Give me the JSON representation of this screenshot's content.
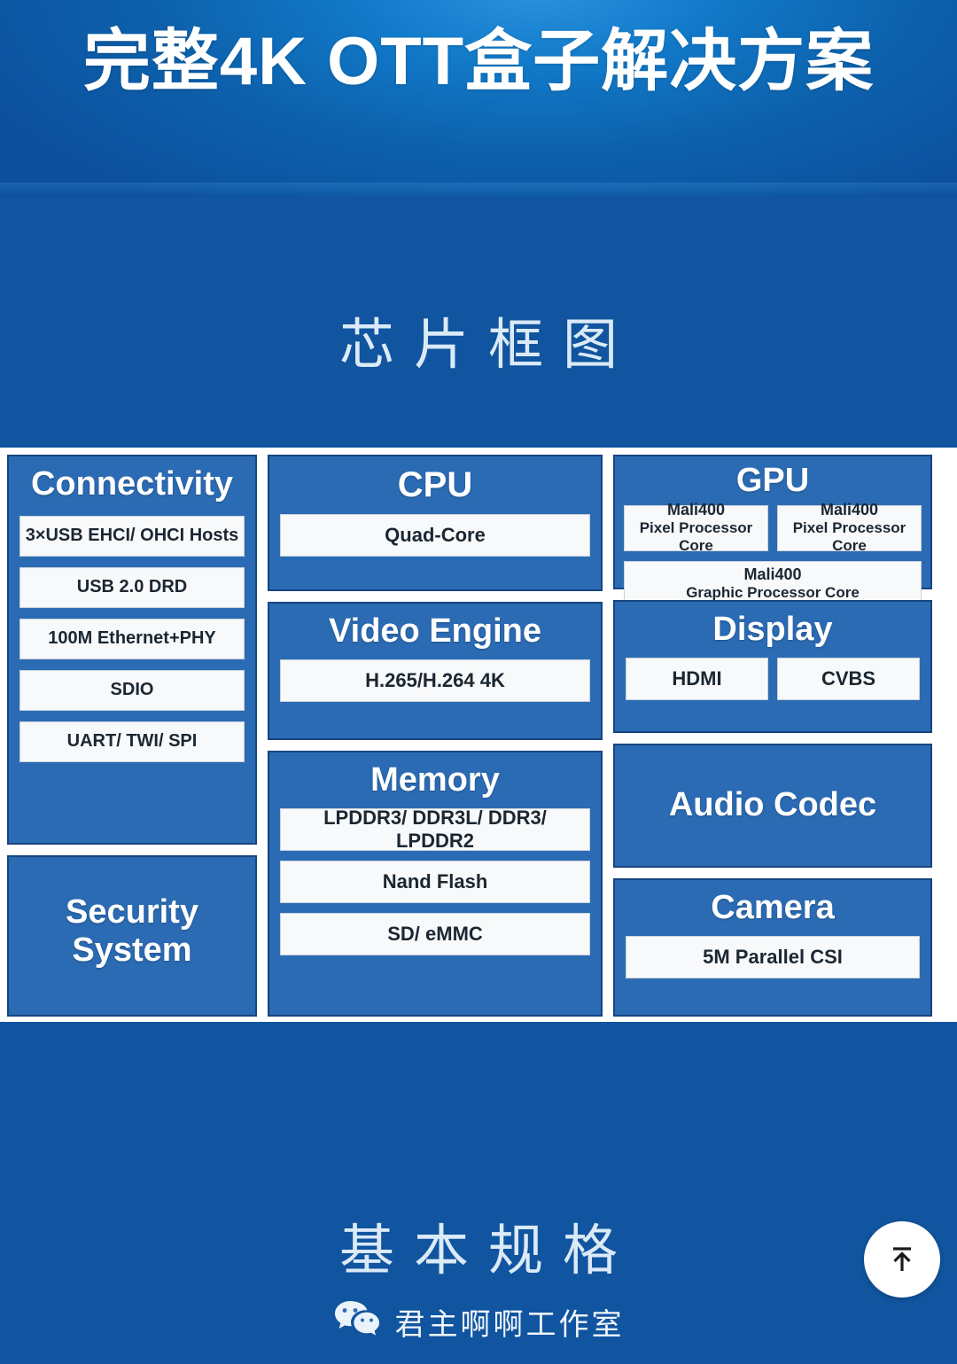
{
  "hero": {
    "title": "完整4K OTT盒子解决方案"
  },
  "sections": {
    "chip_diagram_heading": "芯片框图",
    "basic_specs_heading": "基本规格"
  },
  "diagram": {
    "blocks": [
      {
        "id": "connectivity",
        "title": "Connectivity",
        "items": [
          "3×USB EHCI/ OHCI Hosts",
          "USB 2.0 DRD",
          "100M Ethernet+PHY",
          "SDIO",
          "UART/ TWI/ SPI"
        ]
      },
      {
        "id": "security",
        "title": "Security System",
        "title_line1": "Security",
        "title_line2": "System",
        "items": []
      },
      {
        "id": "cpu",
        "title": "CPU",
        "items": [
          "Quad-Core"
        ]
      },
      {
        "id": "video-engine",
        "title": "Video Engine",
        "items": [
          "H.265/H.264 4K"
        ]
      },
      {
        "id": "memory",
        "title": "Memory",
        "items": [
          "LPDDR3/ DDR3L/ DDR3/ LPDDR2",
          "Nand Flash",
          "SD/ eMMC"
        ]
      },
      {
        "id": "gpu",
        "title": "GPU",
        "items": [
          {
            "line1": "Mali400",
            "line2": "Pixel Processor Core"
          },
          {
            "line1": "Mali400",
            "line2": "Pixel Processor Core"
          },
          {
            "line1": "Mali400",
            "line2": "Graphic Processor Core"
          }
        ]
      },
      {
        "id": "display",
        "title": "Display",
        "items": [
          "HDMI",
          "CVBS"
        ]
      },
      {
        "id": "audio-codec",
        "title": "Audio Codec",
        "items": []
      },
      {
        "id": "camera",
        "title": "Camera",
        "items": [
          "5M Parallel CSI"
        ]
      }
    ]
  },
  "controls": {
    "scroll_top_icon": "arrow-up-to-line-icon"
  },
  "footer": {
    "wechat_icon": "wechat-icon",
    "account_name": "君主啊啊工作室"
  },
  "colors": {
    "header_blue": "#0d62ad",
    "body_blue": "#11549f",
    "block_blue": "#2b6bb4",
    "block_border": "#17447e",
    "item_bg": "#f8f9fa",
    "item_text": "#1b2732",
    "heading_text": "#dbeaf7"
  }
}
